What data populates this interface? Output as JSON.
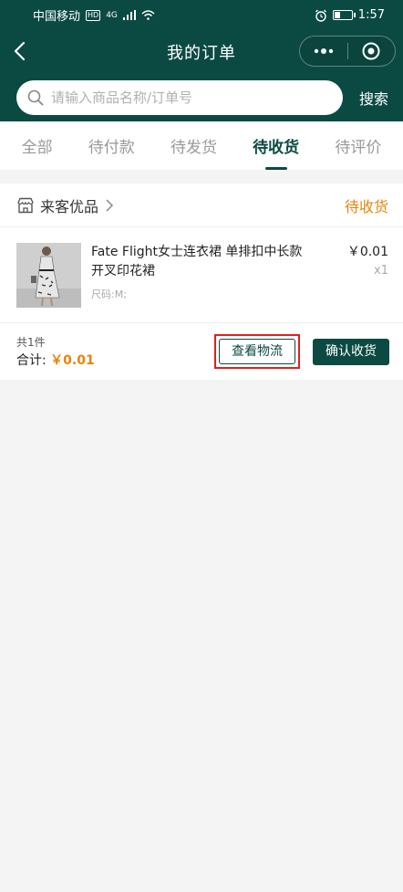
{
  "status_bar": {
    "carrier": "中国移动",
    "hd": "HD",
    "network": "4G",
    "time": "1:57"
  },
  "nav": {
    "title": "我的订单"
  },
  "search": {
    "placeholder": "请输入商品名称/订单号",
    "button": "搜索"
  },
  "tabs": [
    {
      "label": "全部"
    },
    {
      "label": "待付款"
    },
    {
      "label": "待发货"
    },
    {
      "label": "待收货"
    },
    {
      "label": "待评价"
    }
  ],
  "active_tab": "待收货",
  "order": {
    "shop_name": "来客优品",
    "status": "待收货",
    "item": {
      "title": "Fate Flight女士连衣裙 单排扣中长款开叉印花裙",
      "spec": "尺码:M;",
      "price": "￥0.01",
      "qty": "x1"
    },
    "count_text": "共1件",
    "total_label": "合计:",
    "total_amount": "￥0.01",
    "btn_logistics": "查看物流",
    "btn_confirm": "确认收货"
  },
  "colors": {
    "brand": "#0b4a42",
    "accent": "#e3860d",
    "highlight": "#e02020"
  }
}
